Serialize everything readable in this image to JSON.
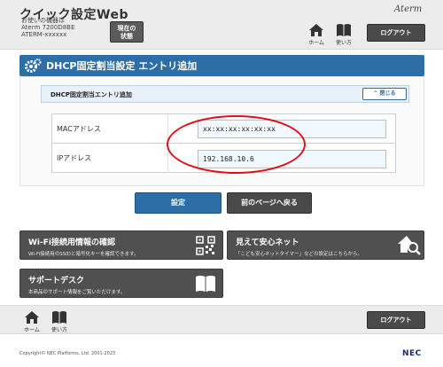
{
  "header": {
    "app_title": "クイック設定Web",
    "device_lines": [
      "お使いの機器は",
      "Aterm 7200D8BE",
      "ATERM-xxxxxx"
    ],
    "status_button": [
      "現在の",
      "状態"
    ],
    "brand_logo": "Aterm",
    "home_label": "ホーム",
    "help_label": "使い方",
    "logout_label": "ログアウト"
  },
  "banner": {
    "title": "DHCP固定割当設定 エントリ追加",
    "icon": "gear-icon"
  },
  "panel": {
    "sub_title": "DHCP固定割当エントリ追加",
    "close_label": "閉じる",
    "rows": [
      {
        "label": "MACアドレス",
        "value": "xx:xx:xx:xx:xx:xx"
      },
      {
        "label": "IPアドレス",
        "value": "192.168.10.6"
      }
    ]
  },
  "actions": {
    "set_label": "設定",
    "back_label": "前のページへ戻る"
  },
  "tiles": [
    {
      "title": "Wi-Fi接続用情報の確認",
      "desc": "Wi-Fi接続用のSSIDと暗号化キーを確認できます。",
      "icon": "qr-code-icon"
    },
    {
      "title": "見えて安心ネット",
      "desc": "「こども安心ネットタイマー」などの設定はこちらから。",
      "icon": "house-search-icon"
    },
    {
      "title": "サポートデスク",
      "desc": "本商品のサポート情報をご覧いただけます。",
      "icon": "book-icon"
    }
  ],
  "footer": {
    "home_label": "ホーム",
    "help_label": "使い方",
    "logout_label": "ログアウト",
    "copyright": "Copyright© NEC Platforms, Ltd. 2001-2023",
    "logo": "NEC"
  },
  "colors": {
    "accent": "#2d6ea6",
    "dark_button": "#4a4a4a",
    "annotation": "#e0101b"
  }
}
